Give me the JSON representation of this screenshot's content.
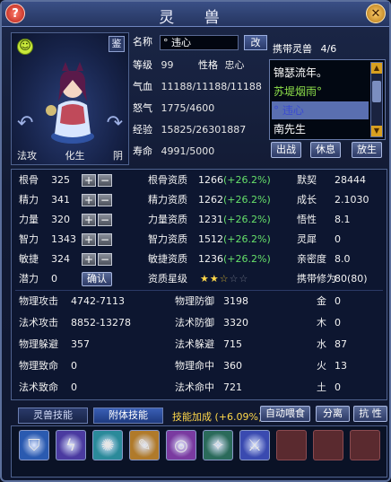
{
  "window": {
    "title": "灵  兽"
  },
  "pet": {
    "name_label": "名称",
    "name_value": "° 违心",
    "rename": "改",
    "level_label": "等级",
    "level": "99",
    "nature_label": "性格",
    "nature": "忠心",
    "hp_label": "气血",
    "hp": "11188/11188/11188",
    "rage_label": "怒气",
    "rage": "1775/4600",
    "exp_label": "经验",
    "exp": "15825/26301887",
    "life_label": "寿命",
    "life": "4991/5000",
    "tags": [
      "法攻",
      "化生",
      "阴"
    ],
    "lock": "鉴"
  },
  "carried": {
    "label": "携带灵兽",
    "count": "4/6",
    "items": [
      {
        "name": "锦瑟流年。",
        "color": "#ffffff",
        "selected": false
      },
      {
        "name": "苏堤烟雨°",
        "color": "#8de04a",
        "selected": false
      },
      {
        "name": "° 违心",
        "color": "#3a4ad0",
        "selected": true
      },
      {
        "name": "南先生",
        "color": "#ffffff",
        "selected": false
      }
    ],
    "buttons": [
      "出战",
      "休息",
      "放生"
    ]
  },
  "stats": {
    "base": [
      {
        "label": "根骨",
        "value": "325"
      },
      {
        "label": "精力",
        "value": "341"
      },
      {
        "label": "力量",
        "value": "320"
      },
      {
        "label": "智力",
        "value": "1343"
      },
      {
        "label": "敏捷",
        "value": "324"
      }
    ],
    "potential_label": "潜力",
    "potential": "0",
    "confirm": "确认",
    "aptitude": [
      {
        "label": "根骨资质",
        "value": "1266",
        "pct": "(+26.2%)"
      },
      {
        "label": "精力资质",
        "value": "1262",
        "pct": "(+26.2%)"
      },
      {
        "label": "力量资质",
        "value": "1231",
        "pct": "(+26.2%)"
      },
      {
        "label": "智力资质",
        "value": "1512",
        "pct": "(+26.2%)"
      },
      {
        "label": "敏捷资质",
        "value": "1236",
        "pct": "(+26.2%)"
      }
    ],
    "star_label": "资质星级",
    "stars": 2.5,
    "right": [
      {
        "label": "默契",
        "value": "28444"
      },
      {
        "label": "成长",
        "value": "2.1030"
      },
      {
        "label": "悟性",
        "value": "8.1"
      },
      {
        "label": "灵犀",
        "value": "0"
      },
      {
        "label": "亲密度",
        "value": "8.0"
      },
      {
        "label": "携带修为",
        "value": "80(80)"
      }
    ],
    "combat_left": [
      {
        "label": "物理攻击",
        "value": "4742-7113"
      },
      {
        "label": "法术攻击",
        "value": "8852-13278"
      },
      {
        "label": "物理躲避",
        "value": "357"
      },
      {
        "label": "物理致命",
        "value": "0"
      },
      {
        "label": "法术致命",
        "value": "0"
      }
    ],
    "combat_mid": [
      {
        "label": "物理防御",
        "value": "3198"
      },
      {
        "label": "法术防御",
        "value": "3320"
      },
      {
        "label": "法术躲避",
        "value": "715"
      },
      {
        "label": "物理命中",
        "value": "360"
      },
      {
        "label": "法术命中",
        "value": "721"
      }
    ],
    "elements": [
      {
        "label": "金",
        "value": "0"
      },
      {
        "label": "木",
        "value": "0"
      },
      {
        "label": "水",
        "value": "87"
      },
      {
        "label": "火",
        "value": "13"
      },
      {
        "label": "土",
        "value": "0"
      }
    ]
  },
  "tabs": {
    "skills": "灵兽技能",
    "attach": "附体技能"
  },
  "bonus": "技能加成 (+6.09%)",
  "actions": {
    "auto_feed": "自动喂食",
    "separate": "分离",
    "resist": "抗 性"
  },
  "skills": [
    {
      "icon": "shield-icon",
      "bg": "#2a5ab0"
    },
    {
      "icon": "lightning-icon",
      "bg": "#4a3aa0"
    },
    {
      "icon": "sparkle-icon",
      "bg": "#2a8a9a"
    },
    {
      "icon": "feather-icon",
      "bg": "#b07a2a"
    },
    {
      "icon": "swirl-icon",
      "bg": "#7a3aa0"
    },
    {
      "icon": "spirit-icon",
      "bg": "#2a6a5a"
    },
    {
      "icon": "sword-icon",
      "bg": "#3a4ab0"
    },
    {
      "icon": "empty-slot",
      "bg": "#5a2a2f"
    },
    {
      "icon": "empty-slot",
      "bg": "#5a2a2f"
    },
    {
      "icon": "empty-slot",
      "bg": "#5a2a2f"
    }
  ]
}
